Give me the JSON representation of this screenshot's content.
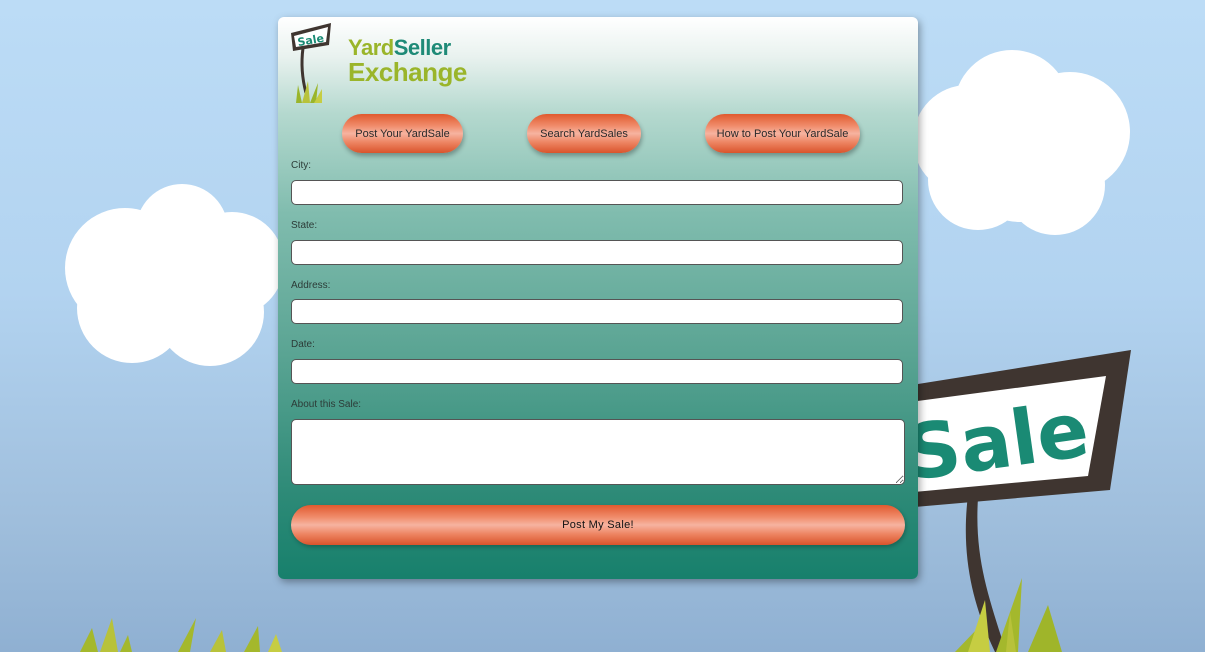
{
  "brand": {
    "logo_line1_a": "Yard",
    "logo_line1_b": "Seller",
    "logo_line2": "Exchange",
    "sign_text": "Sale"
  },
  "nav": {
    "post": "Post Your YardSale",
    "search": "Search YardSales",
    "how_to": "How to Post Your YardSale"
  },
  "form": {
    "city_label": "City:",
    "city_value": "",
    "state_label": "State:",
    "state_value": "",
    "address_label": "Address:",
    "address_value": "",
    "date_label": "Date:",
    "date_value": "",
    "about_label": "About this Sale:",
    "about_value": "",
    "submit_label": "Post My Sale!"
  },
  "background": {
    "sign_text": "Sale"
  },
  "colors": {
    "sky": "#b8d8f4",
    "card_teal": "#17806c",
    "button_orange": "#e05a2e",
    "logo_green": "#9ab52a",
    "logo_teal": "#1e8a77",
    "sign_frame": "#3f3530",
    "grass": "#a4b82c"
  }
}
